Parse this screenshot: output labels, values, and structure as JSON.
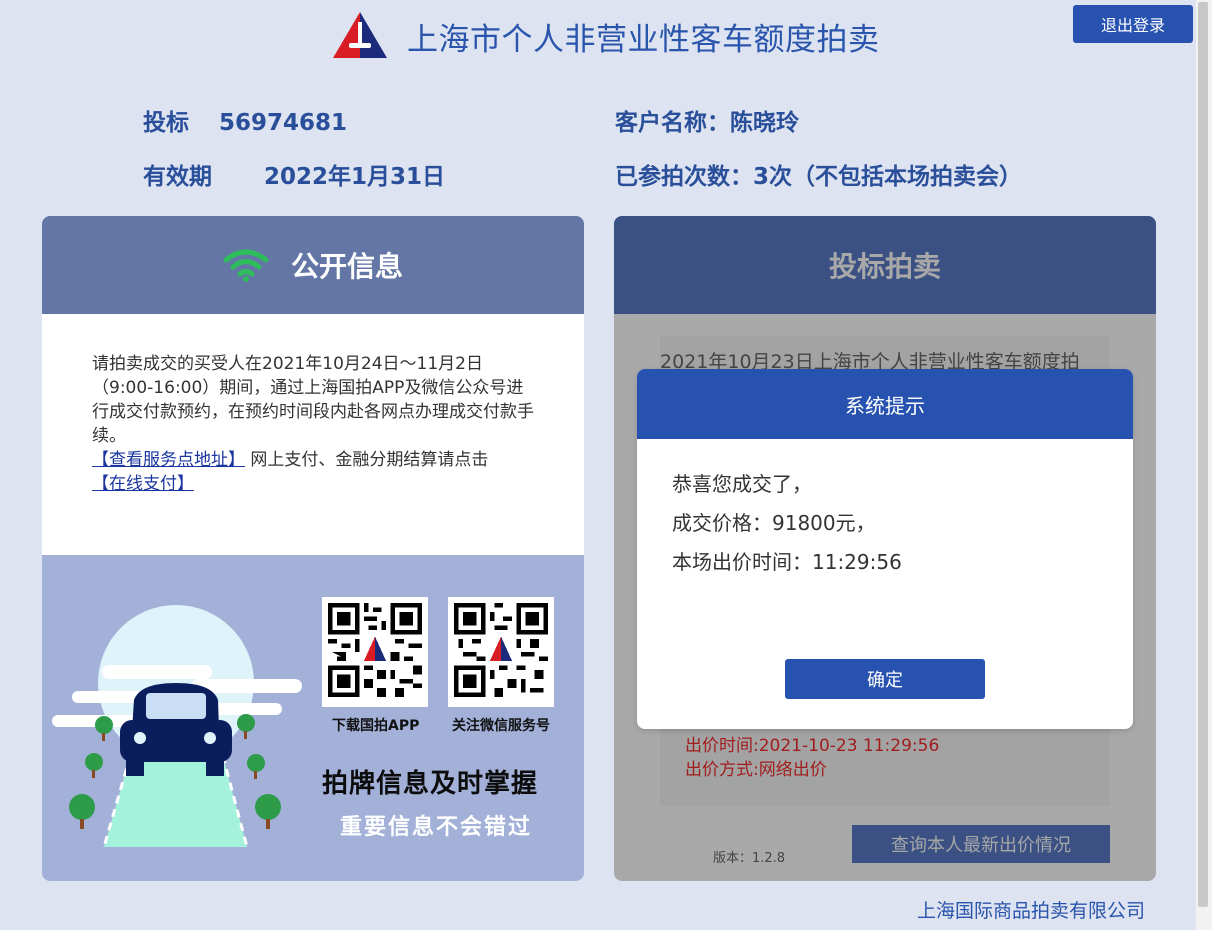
{
  "header": {
    "title": "上海市个人非营业性客车额度拍卖",
    "logout_label": "退出登录"
  },
  "info": {
    "bid_label": "投标",
    "bid_number": "56974681",
    "validity_label": "有效期",
    "validity_date": "2022年1月31日",
    "customer_label": "客户名称：",
    "customer_name": "陈晓玲",
    "participation_text": "已参拍次数：3次（不包括本场拍卖会）"
  },
  "left_panel": {
    "title": "公开信息",
    "notice_text": "请拍卖成交的买受人在2021年10月24日～11月2日（9:00-16:00）期间，通过上海国拍APP及微信公众号进行成交付款预约，在预约时间段内赴各网点办理成交付款手续。",
    "service_link": "【查看服务点地址】",
    "payment_text": " 网上支付、金融分期结算请点击",
    "online_pay_link": "【在线支付】",
    "qr_app_label": "下载国拍APP",
    "qr_wechat_label": "关注微信服务号",
    "promo_headline": "拍牌信息及时掌握",
    "promo_subline": "重要信息不会错过"
  },
  "right_panel": {
    "title": "投标拍卖",
    "auction_name": "2021年10月23日上海市个人非营业性客车额度拍",
    "bid_time": "出价时间:2021-10-23 11:29:56",
    "bid_method": "出价方式:网络出价",
    "version": "版本：1.2.8",
    "query_button": "查询本人最新出价情况"
  },
  "modal": {
    "title": "系统提示",
    "line1": "恭喜您成交了，",
    "line2": "成交价格：91800元，",
    "line3": "本场出价时间：11:29:56",
    "ok_label": "确定"
  },
  "footer": {
    "company": "上海国际商品拍卖有限公司"
  },
  "colors": {
    "primary": "#2752b0",
    "page_bg": "#dde3f0",
    "left_header": "#6376a6",
    "right_header": "#3b5184",
    "promo_bg": "#a3b1d9",
    "wifi_green": "#2dbd5a"
  }
}
